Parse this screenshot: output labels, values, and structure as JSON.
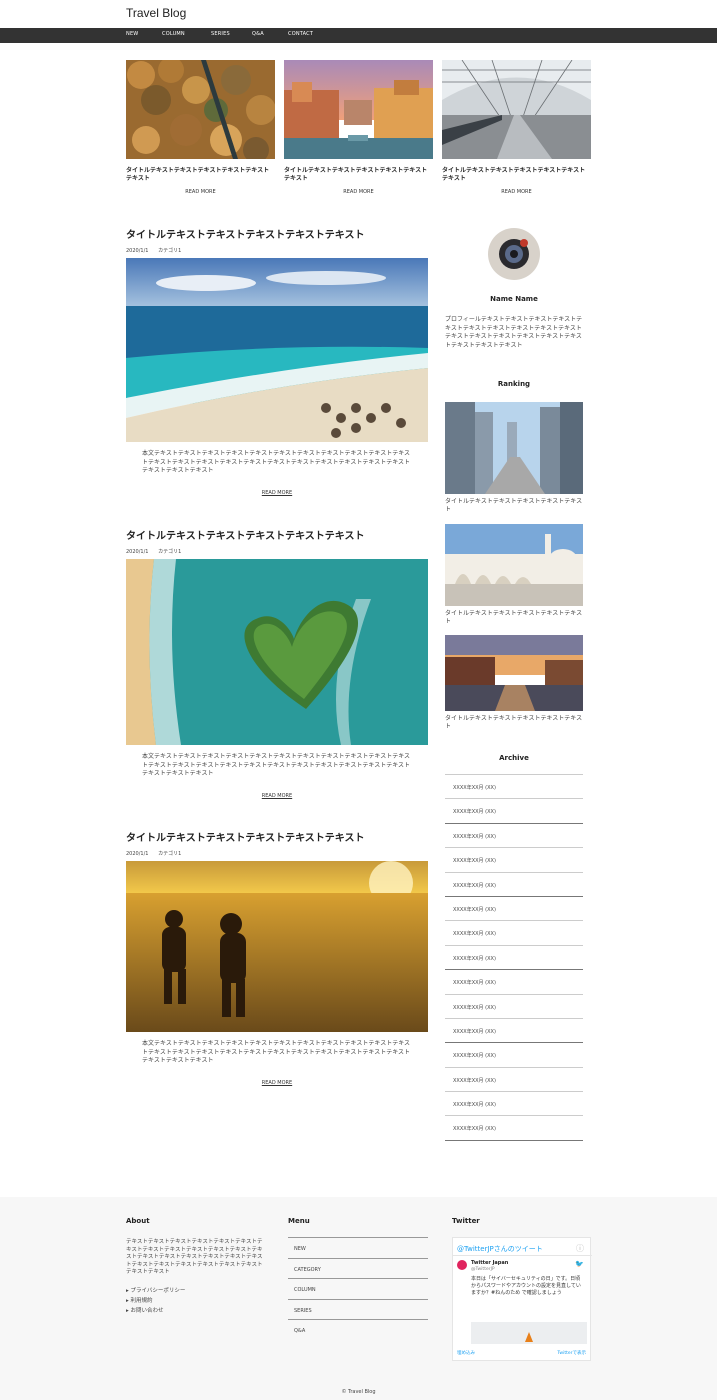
{
  "site": {
    "title": "Travel Blog"
  },
  "nav": {
    "items": [
      "NEW",
      "COLUMN",
      "SERIES",
      "Q&A",
      "CONTACT"
    ]
  },
  "pickup": [
    {
      "title": "タイトルテキストテキストテキストテキストテキストテキスト",
      "more": "READ MORE"
    },
    {
      "title": "タイトルテキストテキストテキストテキストテキストテキスト",
      "more": "READ MORE"
    },
    {
      "title": "タイトルテキストテキストテキストテキストテキストテキスト",
      "more": "READ MORE"
    }
  ],
  "posts": [
    {
      "title": "タイトルテキストテキストテキストテキストテキスト",
      "date": "2020/1/1",
      "category": "カテゴリ1",
      "excerpt": "本文テキストテキストテキストテキストテキストテキストテキストテキストテキストテキストテキストテキストテキストテキストテキストテキストテキストテキストテキストテキストテキストテキストテキストテキストテキスト",
      "more": "READ MORE"
    },
    {
      "title": "タイトルテキストテキストテキストテキストテキスト",
      "date": "2020/1/1",
      "category": "カテゴリ1",
      "excerpt": "本文テキストテキストテキストテキストテキストテキストテキストテキストテキストテキストテキストテキストテキストテキストテキストテキストテキストテキストテキストテキストテキストテキストテキストテキストテキスト",
      "more": "READ MORE"
    },
    {
      "title": "タイトルテキストテキストテキストテキストテキスト",
      "date": "2020/1/1",
      "category": "カテゴリ1",
      "excerpt": "本文テキストテキストテキストテキストテキストテキストテキストテキストテキストテキストテキストテキストテキストテキストテキストテキストテキストテキストテキストテキストテキストテキストテキストテキストテキスト",
      "more": "READ MORE"
    }
  ],
  "sidebar": {
    "profile_name": "Name Name",
    "profile_text": "プロフィールテキストテキストテキストテキストテキストテキストテキストテキストテキストテキストテキストテキストテキストテキストテキストテキストテキストテキストテキスト",
    "ranking_heading": "Ranking",
    "ranking": [
      {
        "title": "タイトルテキストテキストテキストテキストテキスト"
      },
      {
        "title": "タイトルテキストテキストテキストテキストテキスト"
      },
      {
        "title": "タイトルテキストテキストテキストテキストテキスト"
      }
    ],
    "archive_heading": "Archive",
    "archive": [
      "XXXX年XX月 (XX)",
      "XXXX年XX月 (XX)",
      "XXXX年XX月 (XX)",
      "XXXX年XX月 (XX)",
      "XXXX年XX月 (XX)",
      "XXXX年XX月 (XX)",
      "XXXX年XX月 (XX)",
      "XXXX年XX月 (XX)",
      "XXXX年XX月 (XX)",
      "XXXX年XX月 (XX)",
      "XXXX年XX月 (XX)",
      "XXXX年XX月 (XX)",
      "XXXX年XX月 (XX)",
      "XXXX年XX月 (XX)",
      "XXXX年XX月 (XX)"
    ]
  },
  "footer": {
    "about_heading": "About",
    "about_text": "テキストテキストテキストテキストテキストテキストテキストテキストテキストテキストテキストテキストテキストテキストテキストテキストテキストテキストテキストテキストテキストテキストテキストテキストテキストテキストテキスト",
    "links": [
      "プライバシーポリシー",
      "利用規約",
      "お問い合わせ"
    ],
    "menu_heading": "Menu",
    "menu_items": [
      "NEW",
      "CATEGORY",
      "COLUMN",
      "SERIES",
      "Q&A"
    ],
    "twitter_heading": "Twitter",
    "twitter": {
      "header": "@TwitterJPさんのツイート",
      "account_name": "Twitter Japan",
      "handle": "@TwitterJP",
      "tweet": "本日は「サイバーセキュリティの日」です。日頃からパスワードやアカウントの設定を見直していますか？#ねんのため で確認しましょう",
      "embed_link": "埋め込み",
      "view_link": "Twitterで表示"
    },
    "copyright": "© Travel Blog"
  }
}
